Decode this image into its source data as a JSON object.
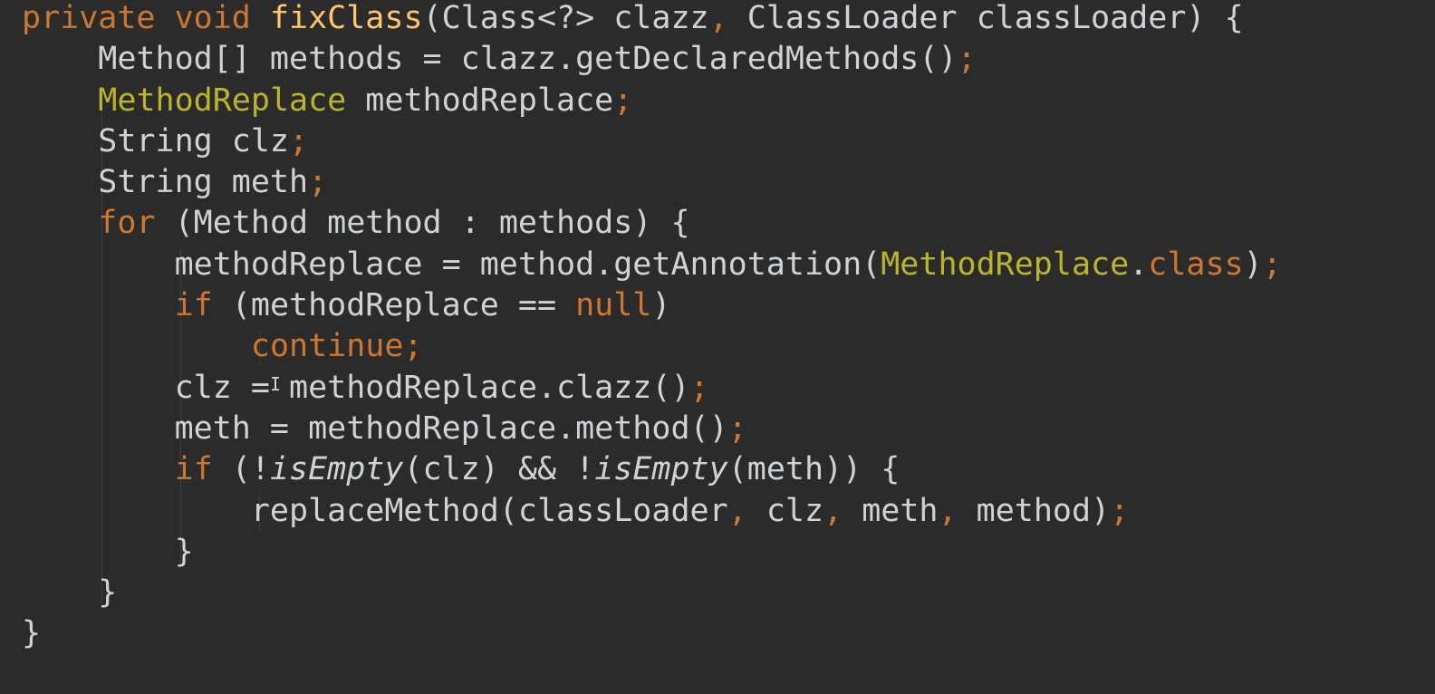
{
  "editor": {
    "background": "#2b2b2b",
    "colors": {
      "keyword": "#cc7832",
      "method_decl": "#ffc66d",
      "annotation": "#bbb529",
      "text": "#cfd3d6",
      "italic_call": "#cfd3d6"
    },
    "cursor_icon": "i-beam-cursor-icon",
    "lines": [
      [
        {
          "t": "private void ",
          "c": "keyword"
        },
        {
          "t": "fixClass",
          "c": "method_decl"
        },
        {
          "t": "(Class<?> clazz",
          "c": "text"
        },
        {
          "t": ", ",
          "c": "keyword"
        },
        {
          "t": "ClassLoader classLoader) {",
          "c": "text"
        }
      ],
      [
        {
          "t": "    Method[] methods = clazz.getDeclaredMethods()",
          "c": "text"
        },
        {
          "t": ";",
          "c": "keyword"
        }
      ],
      [
        {
          "t": "    ",
          "c": "text"
        },
        {
          "t": "MethodReplace",
          "c": "annotation"
        },
        {
          "t": " methodReplace",
          "c": "text"
        },
        {
          "t": ";",
          "c": "keyword"
        }
      ],
      [
        {
          "t": "    String clz",
          "c": "text"
        },
        {
          "t": ";",
          "c": "keyword"
        }
      ],
      [
        {
          "t": "    String meth",
          "c": "text"
        },
        {
          "t": ";",
          "c": "keyword"
        }
      ],
      [
        {
          "t": "    ",
          "c": "text"
        },
        {
          "t": "for ",
          "c": "keyword"
        },
        {
          "t": "(Method method : methods) {",
          "c": "text"
        }
      ],
      [
        {
          "t": "        methodReplace = method.getAnnotation(",
          "c": "text"
        },
        {
          "t": "MethodReplace",
          "c": "annotation"
        },
        {
          "t": ".",
          "c": "text"
        },
        {
          "t": "class",
          "c": "keyword"
        },
        {
          "t": ")",
          "c": "text"
        },
        {
          "t": ";",
          "c": "keyword"
        }
      ],
      [
        {
          "t": "        ",
          "c": "text"
        },
        {
          "t": "if ",
          "c": "keyword"
        },
        {
          "t": "(methodReplace == ",
          "c": "text"
        },
        {
          "t": "null",
          "c": "keyword"
        },
        {
          "t": ")",
          "c": "text"
        }
      ],
      [
        {
          "t": "            ",
          "c": "text"
        },
        {
          "t": "continue;",
          "c": "keyword"
        }
      ],
      [
        {
          "t": "        clz = methodReplace.clazz()",
          "c": "text"
        },
        {
          "t": ";",
          "c": "keyword"
        }
      ],
      [
        {
          "t": "        meth = methodReplace.method()",
          "c": "text"
        },
        {
          "t": ";",
          "c": "keyword"
        }
      ],
      [
        {
          "t": "        ",
          "c": "text"
        },
        {
          "t": "if ",
          "c": "keyword"
        },
        {
          "t": "(!",
          "c": "text"
        },
        {
          "t": "isEmpty",
          "c": "italic_call"
        },
        {
          "t": "(clz) && !",
          "c": "text"
        },
        {
          "t": "isEmpty",
          "c": "italic_call"
        },
        {
          "t": "(meth)) {",
          "c": "text"
        }
      ],
      [
        {
          "t": "            replaceMethod(classLoader",
          "c": "text"
        },
        {
          "t": ", ",
          "c": "keyword"
        },
        {
          "t": "clz",
          "c": "text"
        },
        {
          "t": ", ",
          "c": "keyword"
        },
        {
          "t": "meth",
          "c": "text"
        },
        {
          "t": ", ",
          "c": "keyword"
        },
        {
          "t": "method)",
          "c": "text"
        },
        {
          "t": ";",
          "c": "keyword"
        }
      ],
      [
        {
          "t": "        }",
          "c": "text"
        }
      ],
      [
        {
          "t": "    }",
          "c": "text"
        }
      ],
      [
        {
          "t": "}",
          "c": "text"
        }
      ]
    ]
  }
}
